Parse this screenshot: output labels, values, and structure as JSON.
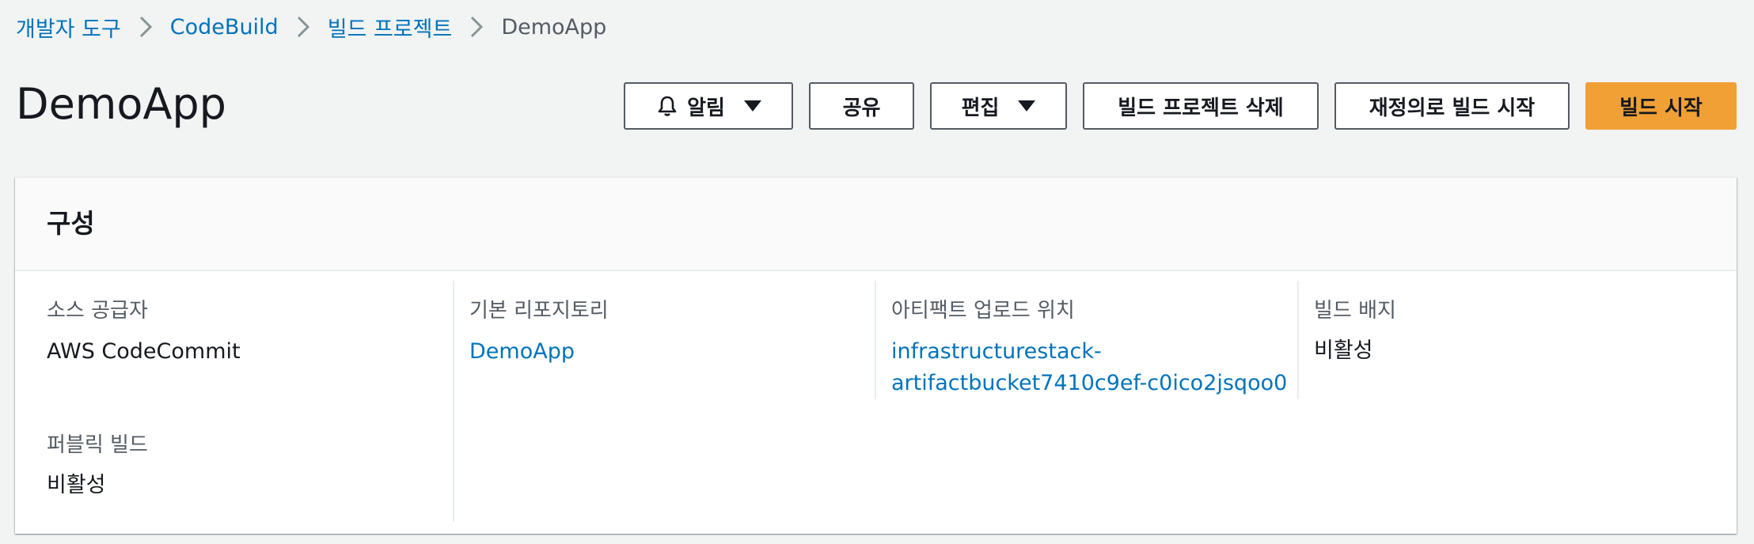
{
  "breadcrumb": {
    "items": [
      {
        "label": "개발자 도구"
      },
      {
        "label": "CodeBuild"
      },
      {
        "label": "빌드 프로젝트"
      }
    ],
    "current": "DemoApp"
  },
  "header": {
    "title": "DemoApp",
    "buttons": {
      "notify": "알림",
      "share": "공유",
      "edit": "편집",
      "delete_project": "빌드 프로젝트 삭제",
      "start_with_overrides": "재정의로 빌드 시작",
      "start_build": "빌드 시작"
    }
  },
  "config_panel": {
    "title": "구성",
    "fields": {
      "source_provider": {
        "label": "소스 공급자",
        "value": "AWS CodeCommit"
      },
      "primary_repository": {
        "label": "기본 리포지토리",
        "value": "DemoApp"
      },
      "artifact_location": {
        "label": "아티팩트 업로드 위치",
        "line1": "infrastructurestack-",
        "line2": "artifactbucket7410c9ef-c0ico2jsqoo0"
      },
      "build_badge": {
        "label": "빌드 배지",
        "value": "비활성"
      },
      "public_build": {
        "label": "퍼블릭 빌드",
        "value": "비활성"
      }
    }
  },
  "colors": {
    "link": "#0073bb",
    "primary_button": "#f0a035",
    "background": "#f2f3f3"
  },
  "icons": {
    "breadcrumb_separator": "chevron-right-icon",
    "notify": "bell-icon",
    "dropdown": "caret-down-icon"
  }
}
